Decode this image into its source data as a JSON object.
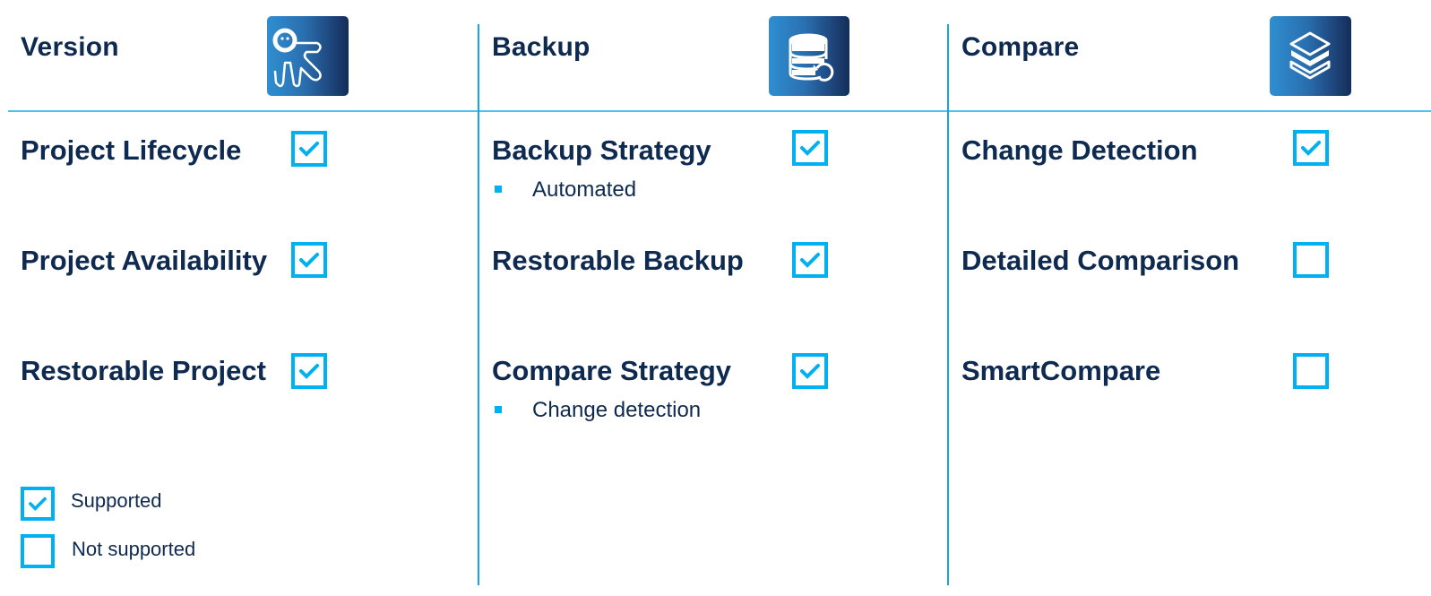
{
  "colors": {
    "accent": "#00b0f0",
    "text": "#0e2a50",
    "divider": "#4cc3ee",
    "icon_gradient": [
      "#2f8fd0",
      "#142d58"
    ]
  },
  "columns": [
    {
      "title": "Version",
      "icon": "octopus-icon",
      "features": [
        {
          "label": "Project Lifecycle",
          "supported": true,
          "sub": null
        },
        {
          "label": "Project Availability",
          "supported": true,
          "sub": null
        },
        {
          "label": "Restorable Project",
          "supported": true,
          "sub": null
        }
      ]
    },
    {
      "title": "Backup",
      "icon": "database-restore-icon",
      "features": [
        {
          "label": "Backup Strategy",
          "supported": true,
          "sub": "Automated"
        },
        {
          "label": "Restorable Backup",
          "supported": true,
          "sub": null
        },
        {
          "label": "Compare Strategy",
          "supported": true,
          "sub": "Change detection"
        }
      ]
    },
    {
      "title": "Compare",
      "icon": "layers-icon",
      "features": [
        {
          "label": "Change Detection",
          "supported": true,
          "sub": null
        },
        {
          "label": "Detailed Comparison",
          "supported": false,
          "sub": null
        },
        {
          "label": "SmartCompare",
          "supported": false,
          "sub": null
        }
      ]
    }
  ],
  "legend": {
    "supported": "Supported",
    "not_supported": "Not supported"
  }
}
